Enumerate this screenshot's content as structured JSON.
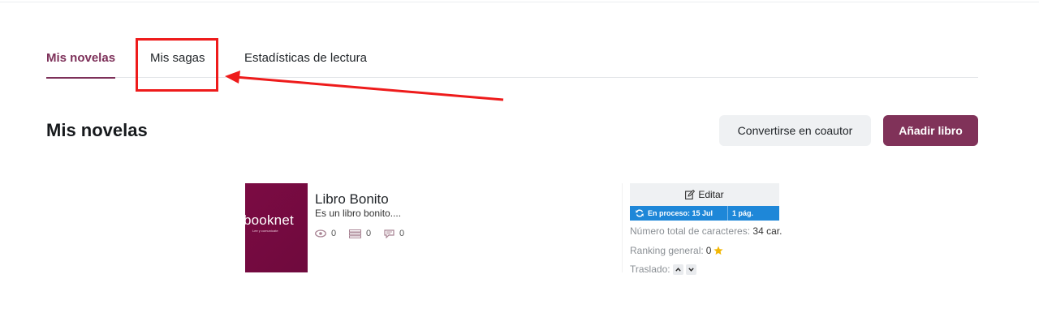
{
  "tabs": [
    {
      "label": "Mis novelas",
      "active": true
    },
    {
      "label": "Mis sagas",
      "active": false
    },
    {
      "label": "Estadísticas de lectura",
      "active": false
    }
  ],
  "heading": "Mis novelas",
  "buttons": {
    "coauthor": "Convertirse en coautor",
    "add_book": "Añadir libro"
  },
  "book": {
    "cover_logo": "booknet",
    "cover_tagline": "Lee y comunícate",
    "title": "Libro Bonito",
    "description": "Es un libro bonito....",
    "views": "0",
    "library": "0",
    "comments": "0",
    "edit_label": "Editar",
    "status": "En proceso: 15 Jul",
    "pages": "1 pág.",
    "chars_label": "Número total de caracteres:",
    "chars_value": "34 car.",
    "ranking_label": "Ranking general:",
    "ranking_value": "0",
    "move_label": "Traslado:"
  },
  "colors": {
    "accent": "#7d3059",
    "status_blue": "#1e87d8",
    "annotation_red": "#ee1b1b",
    "star": "#f2b705"
  }
}
